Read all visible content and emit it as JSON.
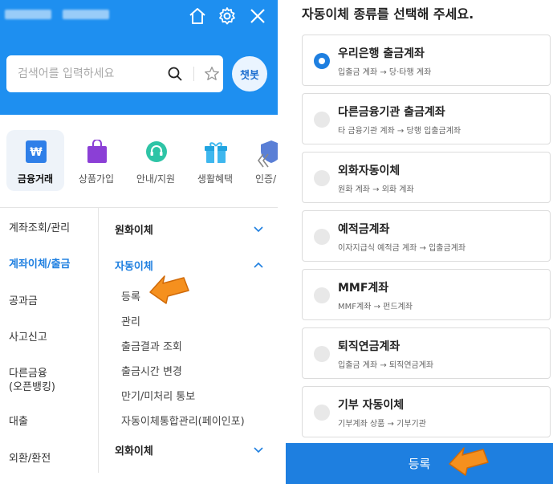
{
  "left": {
    "header": {
      "icons": [
        "home-icon",
        "gear-icon",
        "close-icon"
      ]
    },
    "search": {
      "placeholder": "검색어를 입력하세요",
      "chatbot_label": "챗봇"
    },
    "categories": [
      {
        "label": "금융거래",
        "icon": "won-card-icon",
        "active": true
      },
      {
        "label": "상품가입",
        "icon": "shopping-bag-icon",
        "active": false
      },
      {
        "label": "안내/지원",
        "icon": "headset-icon",
        "active": false
      },
      {
        "label": "생활혜택",
        "icon": "gift-icon",
        "active": false
      },
      {
        "label": "인증/",
        "icon": "shield-icon",
        "active": false
      }
    ],
    "menu": [
      {
        "label": "계좌조회/관리",
        "active": false
      },
      {
        "label": "계좌이체/출금",
        "active": true
      },
      {
        "label": "공과금",
        "active": false
      },
      {
        "label": "사고신고",
        "active": false
      },
      {
        "label": "다른금융\n(오픈뱅킹)",
        "active": false
      },
      {
        "label": "대출",
        "active": false
      },
      {
        "label": "외환/환전",
        "active": false
      }
    ],
    "submenu": {
      "won_transfer": "원화이체",
      "auto_transfer": "자동이체",
      "auto_items": [
        "등록",
        "관리",
        "출금결과 조회",
        "출금시간 변경",
        "만기/미처리 통보",
        "자동이체통합관리(페이인포)"
      ],
      "foreign_transfer": "외화이체"
    },
    "colors": {
      "header_bg": "#1e8ff0",
      "accent": "#1e7fe0"
    }
  },
  "right": {
    "title": "자동이체 종류를 선택해 주세요.",
    "options": [
      {
        "title": "우리은행 출금계좌",
        "desc": "입출금 계좌 → 당·타행 계좌",
        "selected": true
      },
      {
        "title": "다른금융기관 출금계좌",
        "desc": "타 금융기관 계좌 → 당행 입출금계좌",
        "selected": false
      },
      {
        "title": "외화자동이체",
        "desc": "원화 계좌 → 외화 계좌",
        "selected": false
      },
      {
        "title": "예적금계좌",
        "desc": "이자지급식 예적금 계좌 → 입출금계좌",
        "selected": false
      },
      {
        "title": "MMF계좌",
        "desc": "MMF계좌 → 펀드계좌",
        "selected": false
      },
      {
        "title": "퇴직연금계좌",
        "desc": "입출금 계좌 → 퇴직연금계좌",
        "selected": false
      },
      {
        "title": "기부 자동이체",
        "desc": "기부계좌 상품 → 기부기관",
        "selected": false
      }
    ],
    "register_label": "등록"
  },
  "annotations": {
    "arrow_color": "#f5901e"
  }
}
